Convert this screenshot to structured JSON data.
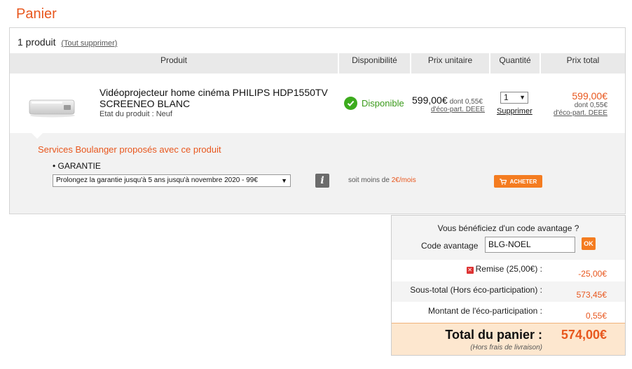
{
  "page": {
    "title": "Panier"
  },
  "cart": {
    "count_label": "1 produit",
    "clear_all": "(Tout supprimer)",
    "headers": {
      "product": "Produit",
      "availability": "Disponibilité",
      "unit_price": "Prix unitaire",
      "quantity": "Quantité",
      "total_price": "Prix total"
    },
    "item": {
      "thumbnail_icon": "projector-thumbnail",
      "name": "Vidéoprojecteur home cinéma PHILIPS HDP1550TV SCREENEO BLANC",
      "state": "Etat du produit : Neuf",
      "availability_icon": "check-circle-icon",
      "availability": "Disponible",
      "unit_price": "599,00€",
      "unit_eco_prefix": "dont 0,55€",
      "unit_eco_link": "d'éco-part. DEEE",
      "quantity": "1",
      "remove": "Supprimer",
      "total_price": "599,00€",
      "total_eco_prefix": "dont 0,55€",
      "total_eco_link": "d'éco-part. DEEE"
    },
    "services": {
      "title": "Services Boulanger proposés avec ce produit",
      "guarantee_label": "• GARANTIE",
      "guarantee_option": "Prolongez la garantie jusqu'à 5 ans jusqu'à novembre 2020 - 99€",
      "info_icon": "info-icon",
      "less_than_prefix": "soit moins de ",
      "less_than_value": "2€/mois",
      "buy_label": "ACHETER",
      "buy_icon": "cart-icon"
    }
  },
  "summary": {
    "promo_question": "Vous bénéficiez d'un code avantage ?",
    "promo_label": "Code avantage",
    "promo_value": "BLG-NOEL",
    "ok_label": "OK",
    "discount_label": "Remise (25,00€) :",
    "discount_value": "-25,00€",
    "subtotal_label": "Sous-total (Hors éco-participation) :",
    "subtotal_value": "573,45€",
    "eco_label": "Montant de l'éco-participation :",
    "eco_value": "0,55€",
    "total_label": "Total du panier :",
    "total_sub": "(Hors frais de livraison)",
    "total_value": "574,00€"
  },
  "colors": {
    "accent": "#e8571e",
    "button": "#f47c20",
    "available": "#3a9a1a",
    "header_bg": "#e9e9e9",
    "total_bg": "#fde7cf"
  }
}
